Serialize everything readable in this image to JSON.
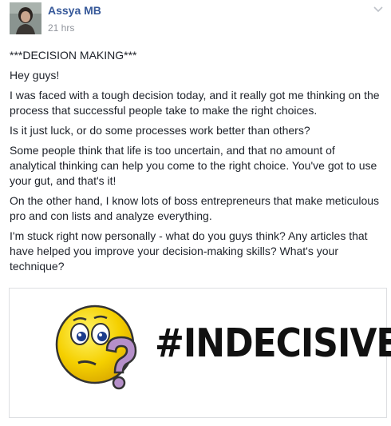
{
  "post": {
    "author": "Assya MB",
    "timestamp": "21 hrs",
    "paragraphs": [
      "***DECISION MAKING***",
      "Hey guys!",
      "I was faced with a tough decision today, and it really got me thinking on the process that successful people take to make the right choices.",
      "Is it just luck, or do some processes work better than others?",
      "Some people think that life is too uncertain, and that no amount of analytical thinking can help you come to the right choice. You've got to use your gut, and that's it!",
      "On the other hand, I know lots of boss entrepreneurs that make meticulous pro and con lists and analyze everything.",
      "I'm stuck right now personally - what do you guys think? Any articles that have helped you improve your decision-making skills? What's your technique?"
    ]
  },
  "attachment": {
    "hashtag": "#INDECISIVE",
    "icon": "confused-question-emoji"
  },
  "colors": {
    "author_link": "#365899",
    "meta_text": "#90949c",
    "body_text": "#1d2129",
    "emoji_face": "#f5d000",
    "question_mark": "#b58fc9"
  }
}
